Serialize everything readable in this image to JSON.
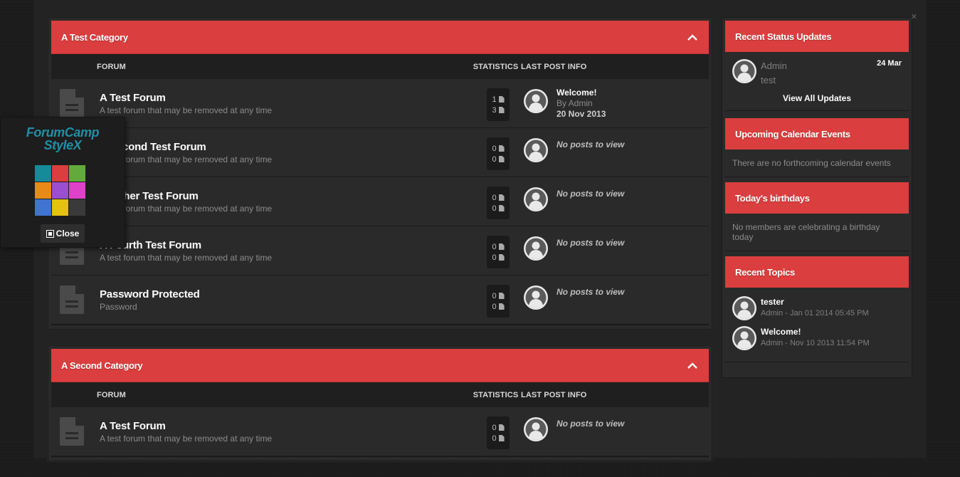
{
  "categories": [
    {
      "title": "A Test Category",
      "columns": {
        "forum": "FORUM",
        "statistics": "STATISTICS",
        "last_post": "LAST POST INFO"
      },
      "forums": [
        {
          "name": "A Test Forum",
          "desc": "A test forum that may be removed at any time",
          "topics": "1",
          "posts": "3",
          "last_title": "Welcome!",
          "last_by": "By Admin",
          "last_date": "20 Nov 2013",
          "no_posts": ""
        },
        {
          "name": "A Second Test Forum",
          "desc": "A test forum that may be removed at any time",
          "topics": "0",
          "posts": "0",
          "last_title": "",
          "last_by": "",
          "last_date": "",
          "no_posts": "No posts to view"
        },
        {
          "name": "Another Test Forum",
          "desc": "A test forum that may be removed at any time",
          "topics": "0",
          "posts": "0",
          "last_title": "",
          "last_by": "",
          "last_date": "",
          "no_posts": "No posts to view"
        },
        {
          "name": "A Fourth Test Forum",
          "desc": "A test forum that may be removed at any time",
          "topics": "0",
          "posts": "0",
          "last_title": "",
          "last_by": "",
          "last_date": "",
          "no_posts": "No posts to view"
        },
        {
          "name": "Password Protected",
          "desc": "Password",
          "topics": "0",
          "posts": "0",
          "last_title": "",
          "last_by": "",
          "last_date": "",
          "no_posts": "No posts to view"
        }
      ]
    },
    {
      "title": "A Second Category",
      "columns": {
        "forum": "FORUM",
        "statistics": "STATISTICS",
        "last_post": "LAST POST INFO"
      },
      "forums": [
        {
          "name": "A Test Forum",
          "desc": "A test forum that may be removed at any time",
          "topics": "0",
          "posts": "0",
          "last_title": "",
          "last_by": "",
          "last_date": "",
          "no_posts": "No posts to view"
        }
      ]
    }
  ],
  "sidebar": {
    "status": {
      "title": "Recent Status Updates",
      "user": "Admin",
      "message": "test",
      "date": "24 Mar",
      "view_all": "View All Updates"
    },
    "calendar": {
      "title": "Upcoming Calendar Events",
      "empty": "There are no forthcoming calendar events"
    },
    "birthdays": {
      "title": "Today's birthdays",
      "empty": "No members are celebrating a birthday today"
    },
    "topics": {
      "title": "Recent Topics",
      "items": [
        {
          "title": "tester",
          "meta": "Admin - Jan 01 2014 05:45 PM"
        },
        {
          "title": "Welcome!",
          "meta": "Admin - Nov 10 2013 11:54 PM"
        }
      ]
    }
  },
  "switcher": {
    "logo_line1": "ForumCamp",
    "logo_line2": "StyleX",
    "close_label": "Close",
    "swatches": [
      "#148a9a",
      "#db3e3e",
      "#63aa3c",
      "#e88a17",
      "#9b4fd0",
      "#e041c9",
      "#3f74d0",
      "#e6c10e",
      "#3a3a3a"
    ]
  },
  "colors": {
    "accent": "#db3e3e",
    "logo": "#1f8fa7"
  },
  "icons": {
    "forum": "document-icon",
    "collapse": "chevron-up-icon",
    "avatar": "user-avatar-icon"
  }
}
